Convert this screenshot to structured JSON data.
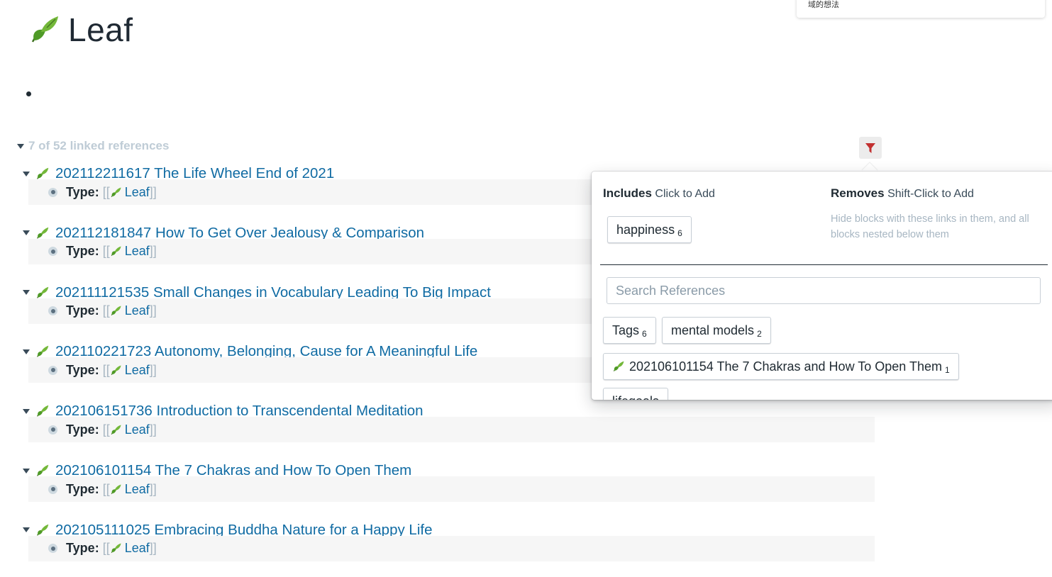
{
  "tooltip": {
    "text": "域的想法"
  },
  "page": {
    "title": "Leaf"
  },
  "linked_references": {
    "count_label": "7 of 52 linked references",
    "items": [
      {
        "title": "202112211617 The Life Wheel End of 2021"
      },
      {
        "title": "202112181847 How To Get Over Jealousy & Comparison"
      },
      {
        "title": "202111121535 Small Changes in Vocabulary Leading To Big Impact"
      },
      {
        "title": "202110221723 Autonomy, Belonging, Cause for A Meaningful Life"
      },
      {
        "title": "202106151736 Introduction to Transcendental Meditation"
      },
      {
        "title": "202106101154 The 7 Chakras and How To Open Them"
      },
      {
        "title": "202105111025 Embracing Buddha Nature for a Happy Life"
      }
    ],
    "block": {
      "attr_name": "Type",
      "colon": ":",
      "open_bracket": "[[",
      "link_text": "Leaf",
      "close_bracket": "]]"
    }
  },
  "filter": {
    "includes_label": "Includes",
    "includes_hint": "Click to Add",
    "removes_label": "Removes",
    "removes_hint": "Shift-Click to Add",
    "removes_desc": "Hide blocks with these links in them, and all blocks nested below them",
    "included_chip": {
      "label": "happiness",
      "count": "6"
    },
    "search_placeholder": "Search References",
    "chips": [
      {
        "label": "Tags",
        "count": "6"
      },
      {
        "label": "mental models",
        "count": "2"
      },
      {
        "label": "202106101154 The 7 Chakras and How To Open Them",
        "count": "1"
      },
      {
        "label": "lifegoals",
        "count": ""
      }
    ]
  },
  "colors": {
    "link": "#106ba3",
    "filter_icon": "#c23030",
    "leaf_green": "#5a9e2f"
  },
  "icons": {
    "page_icon": "leaf-icon",
    "filter_icon": "funnel-icon",
    "caret": "caret-down-icon"
  }
}
